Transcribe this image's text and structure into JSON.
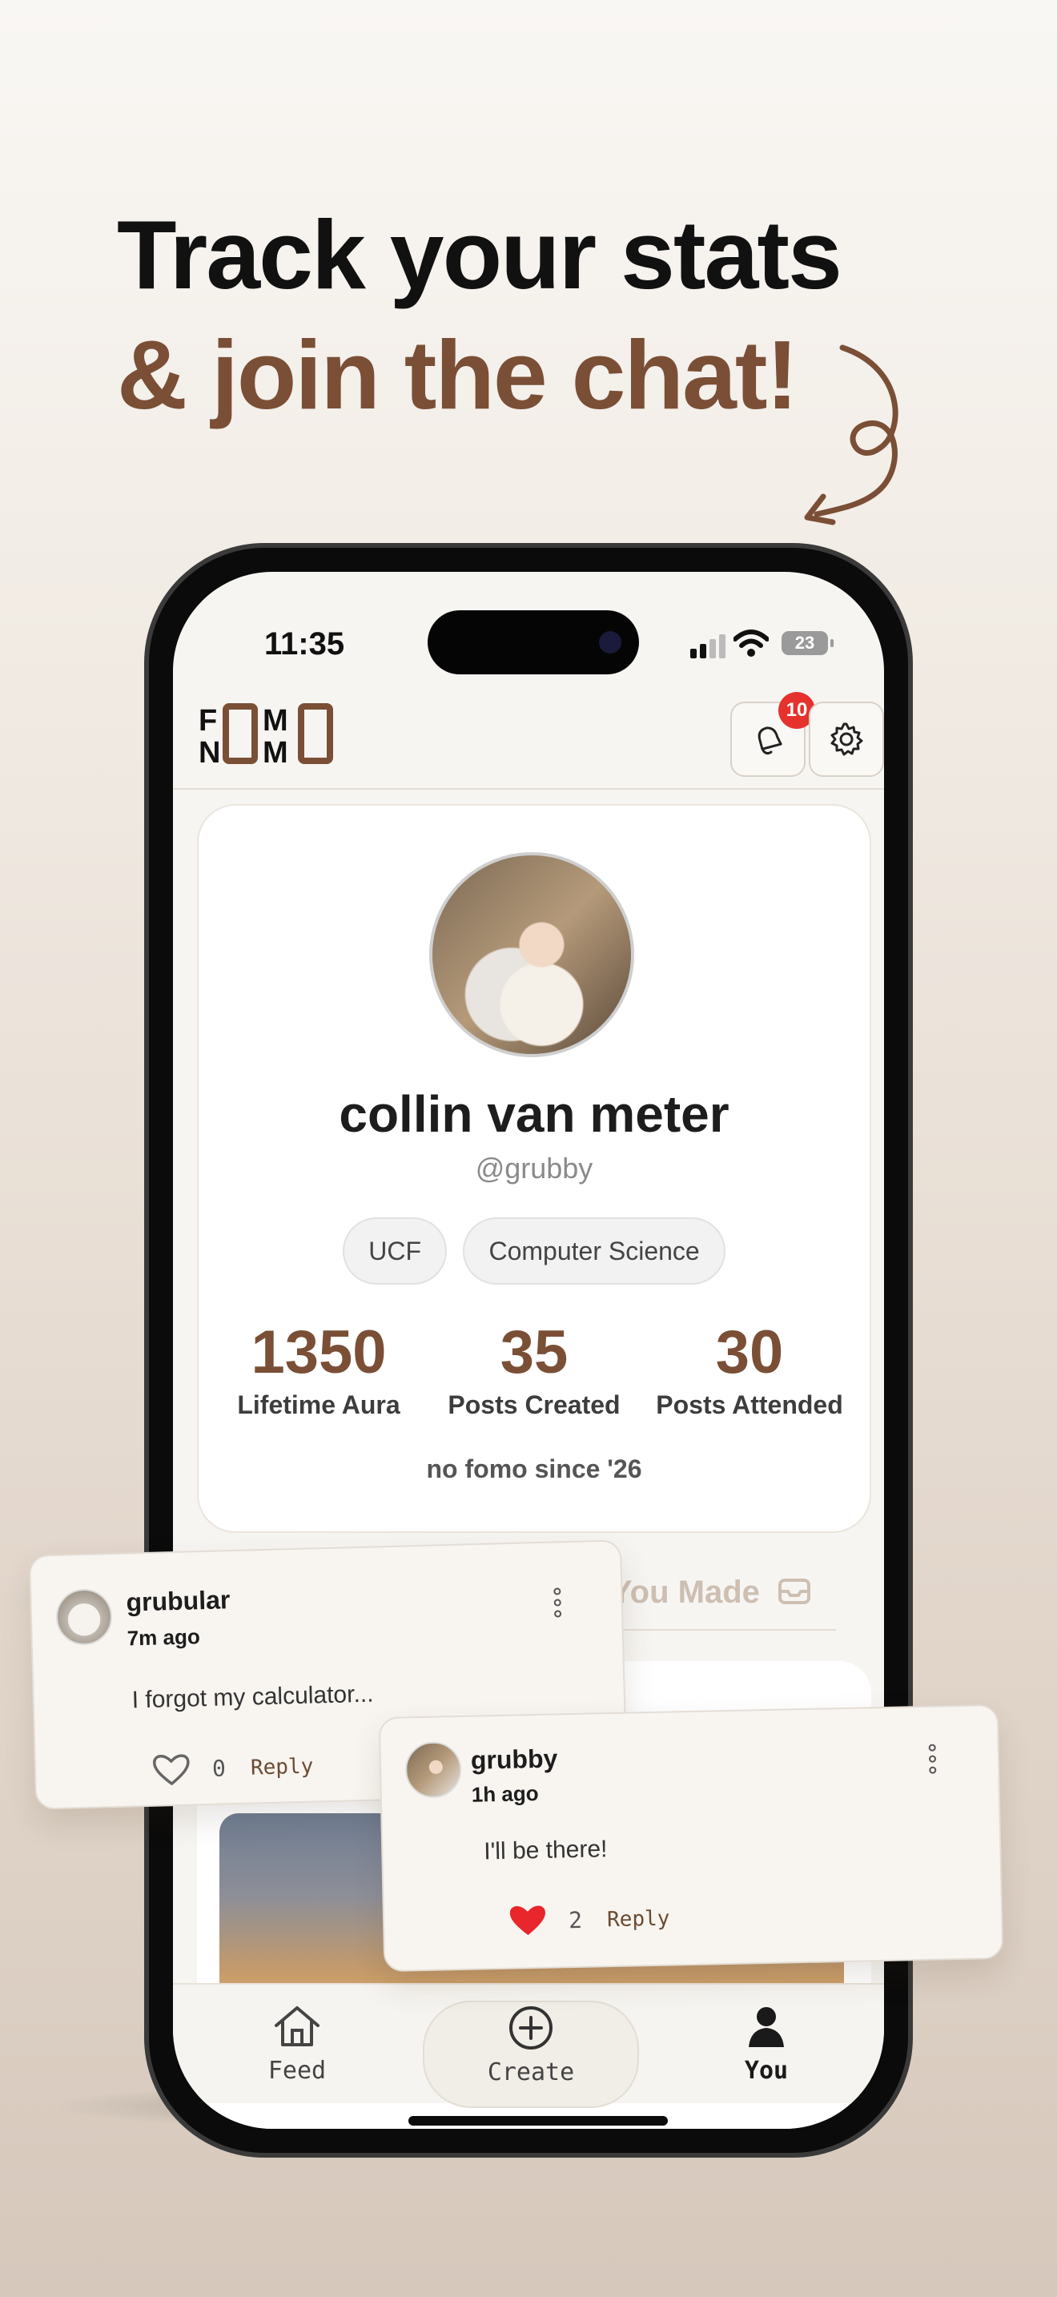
{
  "headline": {
    "line1": "Track your stats",
    "line2": "& join the chat!"
  },
  "status_bar": {
    "time": "11:35",
    "battery": "23"
  },
  "app": {
    "logo_text": "FOMO NOMO",
    "notification_count": "10"
  },
  "profile": {
    "name": "collin van meter",
    "handle": "@grubby",
    "chips": [
      "UCF",
      "Computer Science"
    ],
    "stats": [
      {
        "value": "1350",
        "label": "Lifetime Aura"
      },
      {
        "value": "35",
        "label": "Posts Created"
      },
      {
        "value": "30",
        "label": "Posts Attended"
      }
    ],
    "since": "no fomo since '26"
  },
  "section": {
    "title": "s You Made"
  },
  "comments": [
    {
      "user": "grubular",
      "ago": "7m ago",
      "text": "I forgot my calculator...",
      "likes": "0",
      "reply": "Reply"
    },
    {
      "user": "grubby",
      "ago": "1h ago",
      "text": "I'll be there!",
      "likes": "2",
      "reply": "Reply"
    }
  ],
  "tabs": [
    {
      "label": "Feed",
      "icon": "home-icon"
    },
    {
      "label": "Create",
      "icon": "plus-circle-icon"
    },
    {
      "label": "You",
      "icon": "person-icon"
    }
  ],
  "colors": {
    "brand_brown": "#7a4f36",
    "badge_red": "#e5322d",
    "heart_red": "#e8262b"
  }
}
